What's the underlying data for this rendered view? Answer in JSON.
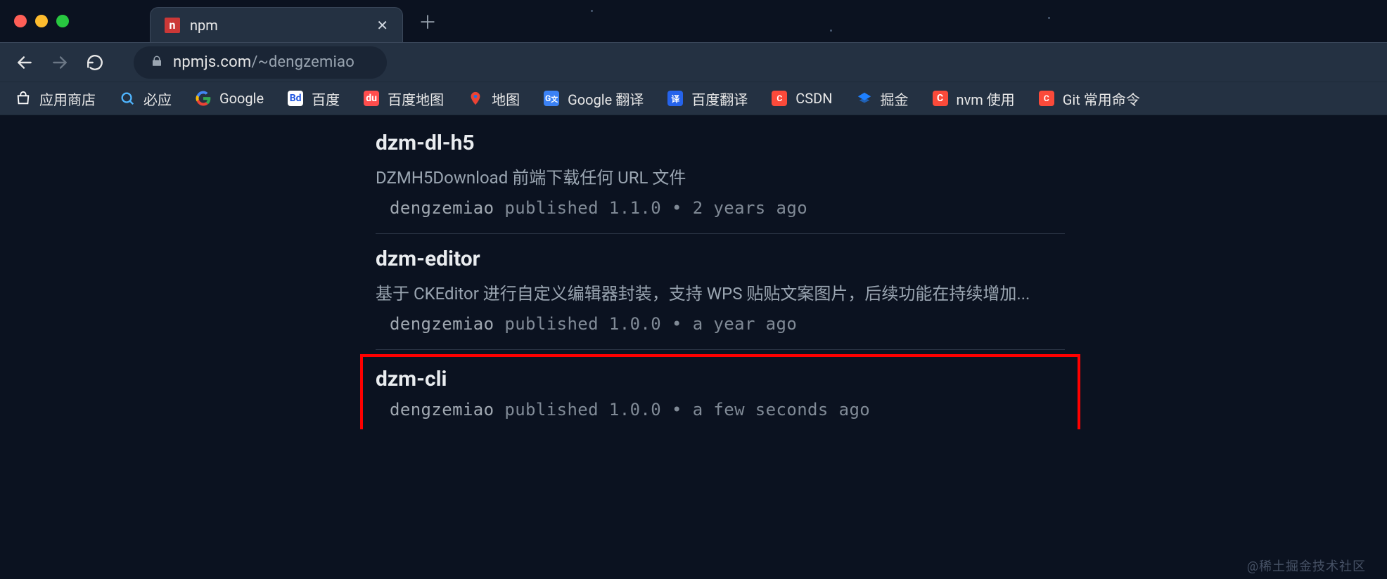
{
  "browser": {
    "tab": {
      "title": "npm",
      "favicon_letter": "n"
    },
    "url_host": "npmjs.com",
    "url_path": "/~dengzemiao"
  },
  "bookmarks": [
    {
      "id": "app-store",
      "label": "应用商店",
      "icon": "store"
    },
    {
      "id": "bing",
      "label": "必应",
      "icon": "bing"
    },
    {
      "id": "google",
      "label": "Google",
      "icon": "google"
    },
    {
      "id": "baidu",
      "label": "百度",
      "icon": "baidu"
    },
    {
      "id": "baidu-map",
      "label": "百度地图",
      "icon": "bdmap"
    },
    {
      "id": "ditu",
      "label": "地图",
      "icon": "ditu"
    },
    {
      "id": "google-translate",
      "label": "Google 翻译",
      "icon": "gtrans"
    },
    {
      "id": "baidu-translate",
      "label": "百度翻译",
      "icon": "bdtrans"
    },
    {
      "id": "csdn",
      "label": "CSDN",
      "icon": "csdn"
    },
    {
      "id": "juejin",
      "label": "掘金",
      "icon": "juejin"
    },
    {
      "id": "nvm",
      "label": "nvm 使用",
      "icon": "c"
    },
    {
      "id": "git",
      "label": "Git 常用命令",
      "icon": "git"
    }
  ],
  "packages": [
    {
      "name": "dzm-dl-h5",
      "description": "DZMH5Download 前端下载任何 URL 文件",
      "author": "dengzemiao",
      "published_word": "published",
      "version": "1.1.0",
      "sep": "•",
      "time": "2 years ago",
      "highlighted": false
    },
    {
      "name": "dzm-editor",
      "description": "基于 CKEditor 进行自定义编辑器封装，支持 WPS 贴贴文案图片，后续功能在持续增加...",
      "author": "dengzemiao",
      "published_word": "published",
      "version": "1.0.0",
      "sep": "•",
      "time": "a year ago",
      "highlighted": false
    },
    {
      "name": "dzm-cli",
      "description": "",
      "author": "dengzemiao",
      "published_word": "published",
      "version": "1.0.0",
      "sep": "•",
      "time": "a few seconds ago",
      "highlighted": true
    }
  ],
  "watermark": "@稀土掘金技术社区"
}
